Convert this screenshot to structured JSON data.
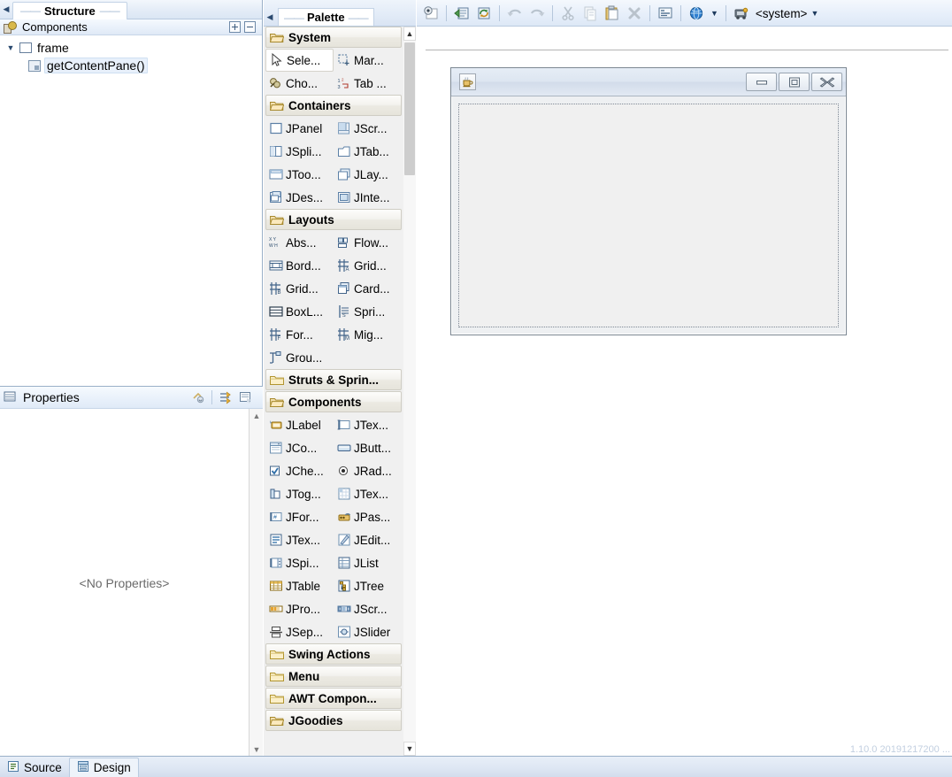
{
  "structure": {
    "tab_label": "Structure",
    "dash_left": "——",
    "dash_right": "——",
    "components_header": "Components",
    "expand_all_tooltip": "+",
    "collapse_all_tooltip": "−",
    "tree": [
      {
        "label": "frame",
        "icon": "frame-icon",
        "expanded": true,
        "selected": false
      },
      {
        "label": "getContentPane()",
        "icon": "content-pane-icon",
        "expanded": false,
        "selected": true
      }
    ]
  },
  "properties": {
    "title": "Properties",
    "empty_message": "<No Properties>",
    "tools": [
      "restore-default-icon",
      "show-advanced-icon",
      "show-events-icon"
    ]
  },
  "palette": {
    "tab_label": "Palette",
    "dash_left": "——",
    "dash_right": "——",
    "categories": [
      {
        "name": "System",
        "open": true,
        "items": [
          {
            "label": "Sele...",
            "icon": "cursor-icon",
            "selected": true
          },
          {
            "label": "Mar...",
            "icon": "marquee-icon",
            "selected": false
          },
          {
            "label": "Cho...",
            "icon": "choose-component-icon",
            "selected": false
          },
          {
            "label": "Tab ...",
            "icon": "tab-order-icon",
            "selected": false
          }
        ]
      },
      {
        "name": "Containers",
        "open": true,
        "items": [
          {
            "label": "JPanel",
            "icon": "jpanel-icon",
            "selected": false
          },
          {
            "label": "JScr...",
            "icon": "jscrollpane-icon",
            "selected": false
          },
          {
            "label": "JSpli...",
            "icon": "jsplitpane-icon",
            "selected": false
          },
          {
            "label": "JTab...",
            "icon": "jtabbedpane-icon",
            "selected": false
          },
          {
            "label": "JToo...",
            "icon": "jtoolbar-icon",
            "selected": false
          },
          {
            "label": "JLay...",
            "icon": "jlayeredpane-icon",
            "selected": false
          },
          {
            "label": "JDes...",
            "icon": "jdesktoppane-icon",
            "selected": false
          },
          {
            "label": "JInte...",
            "icon": "jinternalframe-icon",
            "selected": false
          }
        ]
      },
      {
        "name": "Layouts",
        "open": true,
        "items": [
          {
            "label": "Abs...",
            "icon": "absolute-layout-icon",
            "selected": false
          },
          {
            "label": "Flow...",
            "icon": "flow-layout-icon",
            "selected": false
          },
          {
            "label": "Bord...",
            "icon": "border-layout-icon",
            "selected": false
          },
          {
            "label": "Grid...",
            "icon": "gridbag-layout-icon",
            "selected": false
          },
          {
            "label": "Grid...",
            "icon": "grid-layout-icon",
            "selected": false
          },
          {
            "label": "Card...",
            "icon": "card-layout-icon",
            "selected": false
          },
          {
            "label": "BoxL...",
            "icon": "box-layout-icon",
            "selected": false
          },
          {
            "label": "Spri...",
            "icon": "spring-layout-icon",
            "selected": false
          },
          {
            "label": "For...",
            "icon": "form-layout-icon",
            "selected": false
          },
          {
            "label": "Mig...",
            "icon": "mig-layout-icon",
            "selected": false
          },
          {
            "label": "Grou...",
            "icon": "group-layout-icon",
            "selected": false
          }
        ]
      },
      {
        "name": "Struts & Sprin...",
        "open": false,
        "items": []
      },
      {
        "name": "Components",
        "open": true,
        "items": [
          {
            "label": "JLabel",
            "icon": "jlabel-icon",
            "selected": false
          },
          {
            "label": "JTex...",
            "icon": "jtextfield-icon",
            "selected": false
          },
          {
            "label": "JCo...",
            "icon": "jcombobox-icon",
            "selected": false
          },
          {
            "label": "JButt...",
            "icon": "jbutton-icon",
            "selected": false
          },
          {
            "label": "JChe...",
            "icon": "jcheckbox-icon",
            "selected": false
          },
          {
            "label": "JRad...",
            "icon": "jradiobutton-icon",
            "selected": false
          },
          {
            "label": "JTog...",
            "icon": "jtogglebutton-icon",
            "selected": false
          },
          {
            "label": "JTex...",
            "icon": "jtextarea-icon",
            "selected": false
          },
          {
            "label": "JFor...",
            "icon": "jformattedtextfield-icon",
            "selected": false
          },
          {
            "label": "JPas...",
            "icon": "jpasswordfield-icon",
            "selected": false
          },
          {
            "label": "JTex...",
            "icon": "jtextpane-icon",
            "selected": false
          },
          {
            "label": "JEdit...",
            "icon": "jeditorpane-icon",
            "selected": false
          },
          {
            "label": "JSpi...",
            "icon": "jspinner-icon",
            "selected": false
          },
          {
            "label": "JList",
            "icon": "jlist-icon",
            "selected": false
          },
          {
            "label": "JTable",
            "icon": "jtable-icon",
            "selected": false
          },
          {
            "label": "JTree",
            "icon": "jtree-icon",
            "selected": false
          },
          {
            "label": "JPro...",
            "icon": "jprogressbar-icon",
            "selected": false
          },
          {
            "label": "JScr...",
            "icon": "jscrollbar-icon",
            "selected": false
          },
          {
            "label": "JSep...",
            "icon": "jseparator-icon",
            "selected": false
          },
          {
            "label": "JSlider",
            "icon": "jslider-icon",
            "selected": false
          }
        ]
      },
      {
        "name": "Swing Actions",
        "open": false,
        "items": []
      },
      {
        "name": "Menu",
        "open": false,
        "items": []
      },
      {
        "name": "AWT Compon...",
        "open": false,
        "items": []
      },
      {
        "name": "JGoodies",
        "open": true,
        "items": []
      }
    ]
  },
  "editor": {
    "toolbar": [
      {
        "name": "test-icon",
        "kind": "icon"
      },
      {
        "name": "separator",
        "kind": "sep"
      },
      {
        "name": "open-source-icon",
        "kind": "icon"
      },
      {
        "name": "refresh-icon",
        "kind": "icon"
      },
      {
        "name": "separator",
        "kind": "sep"
      },
      {
        "name": "undo-icon",
        "kind": "icon"
      },
      {
        "name": "redo-icon",
        "kind": "icon"
      },
      {
        "name": "separator",
        "kind": "sep"
      },
      {
        "name": "cut-icon",
        "kind": "icon"
      },
      {
        "name": "copy-icon",
        "kind": "icon"
      },
      {
        "name": "paste-icon",
        "kind": "icon"
      },
      {
        "name": "delete-icon",
        "kind": "icon"
      },
      {
        "name": "separator",
        "kind": "sep"
      },
      {
        "name": "externalize-strings-icon",
        "kind": "icon"
      },
      {
        "name": "separator",
        "kind": "sep"
      },
      {
        "name": "locale-globe-icon",
        "kind": "icon"
      },
      {
        "name": "locale-dropdown-arrow",
        "kind": "arrow"
      },
      {
        "name": "separator",
        "kind": "sep"
      },
      {
        "name": "look-and-feel-icon",
        "kind": "icon"
      },
      {
        "name": "look-and-feel-label",
        "kind": "label",
        "text": "<system>"
      },
      {
        "name": "look-and-feel-dropdown-arrow",
        "kind": "arrow"
      }
    ],
    "laf_value": "<system>",
    "design_frame": {
      "title": "",
      "app_icon": "java-coffee-cup-icon",
      "buttons": [
        {
          "name": "minimize-button",
          "glyph": "minimize"
        },
        {
          "name": "maximize-button",
          "glyph": "maximize"
        },
        {
          "name": "close-button",
          "glyph": "close"
        }
      ],
      "content_pane_label": ""
    },
    "version_text": "1.10.0  20191217200 ..."
  },
  "bottom_tabs": [
    {
      "label": "Source",
      "icon": "source-icon",
      "active": false
    },
    {
      "label": "Design",
      "icon": "design-icon",
      "active": true
    }
  ]
}
